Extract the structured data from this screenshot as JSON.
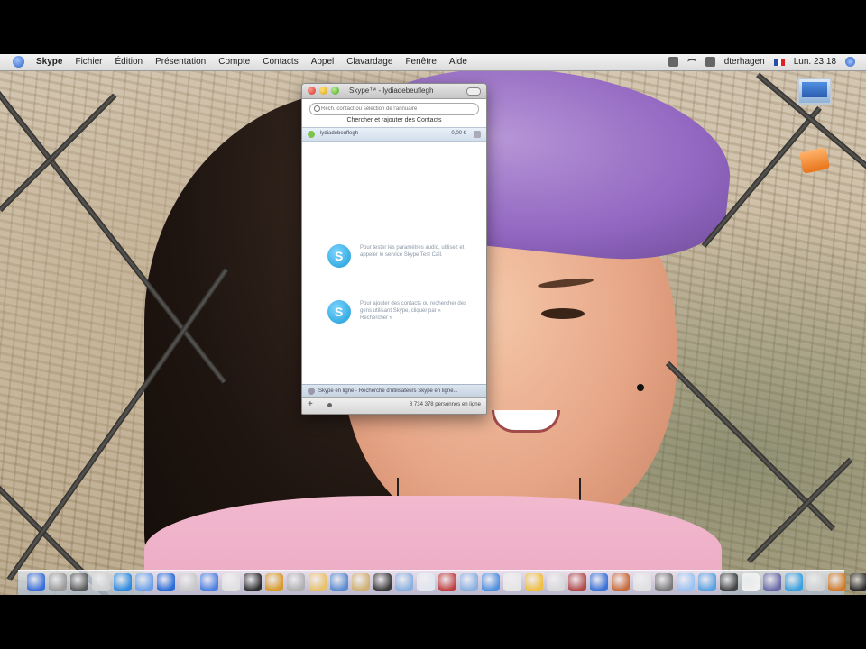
{
  "menubar": {
    "app_name": "Skype",
    "menus": [
      "Fichier",
      "Édition",
      "Présentation",
      "Compte",
      "Contacts",
      "Appel",
      "Clavardage",
      "Fenêtre",
      "Aide"
    ],
    "user": "dterhagen",
    "clock": "Lun. 23:18"
  },
  "skype": {
    "title": "Skype™ - lydiadebeuflegh",
    "search_placeholder": "Rech. contact ou sélection de l'annuaire",
    "find_link": "Chercher et rajouter des Contacts",
    "contact": {
      "name": "lydiadebeuflegh",
      "credit": "0,00 €"
    },
    "tips": [
      {
        "icon": "skype-logo-icon",
        "text": "Pour tester les paramètres audio, utilisez et appeler le service Skype Test Call."
      },
      {
        "icon": "skype-logo-icon",
        "text": "Pour ajouter des contacts ou rechercher des gens utilisant Skype, cliquer par « Rechercher »"
      }
    ],
    "status_text": "Skype en ligne - Recherche d'utilisateurs Skype en ligne...",
    "online_count": "8 734 378 personnes en ligne"
  },
  "dock": {
    "colors": [
      "#3a6fd8",
      "#9a9a9a",
      "#5a5a5a",
      "#d0d0d0",
      "#2f8ae0",
      "#6aa0e8",
      "#2b6cd6",
      "#c8c8c8",
      "#4b7fe0",
      "#e0e0e0",
      "#2e2e2e",
      "#d89a2a",
      "#b0b0b0",
      "#e8c16a",
      "#5a8ad0",
      "#d0b070",
      "#3a3a3a",
      "#8ab0e0",
      "#e0e6ee",
      "#c04040",
      "#8ab0e0",
      "#5090e0",
      "#e6e6e6",
      "#f0c040",
      "#d8d8d8",
      "#b04a4a",
      "#3a72d8",
      "#c86a3a",
      "#e0e0e0",
      "#7a7a7a",
      "#9cc2f0",
      "#5aa0e0",
      "#444444",
      "#f0f0f0",
      "#6a6aa8",
      "#3aa0e0",
      "#d0d0d0",
      "#d07a2a",
      "#2a2a2a",
      "#3a60c0",
      "#d8d8d8",
      "#888888",
      "#b8c8e0",
      "#606060",
      "#9a9a9a"
    ]
  }
}
